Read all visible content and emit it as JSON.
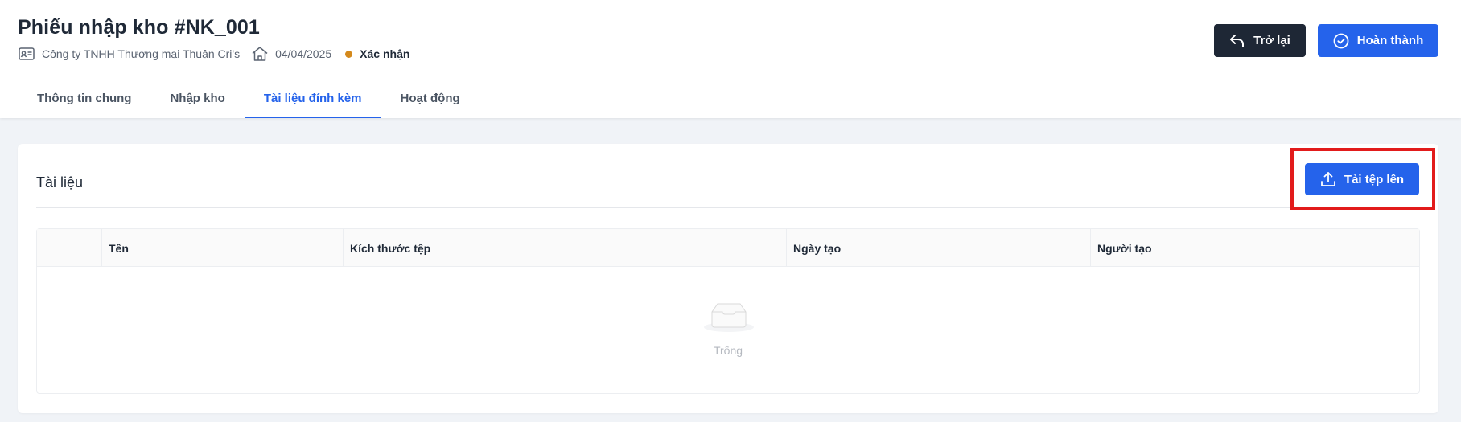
{
  "header": {
    "title": "Phiếu nhập kho #NK_001",
    "company": "Công ty TNHH Thương mại Thuận Cri's",
    "date": "04/04/2025",
    "status": "Xác nhận",
    "status_color": "#d4891c",
    "company_icon": "id-card-icon",
    "home_icon": "home-icon"
  },
  "actions": {
    "back_label": "Trở lại",
    "done_label": "Hoàn thành",
    "back_icon": "undo-arrow-icon",
    "done_icon": "check-circle-icon"
  },
  "tabs": [
    {
      "label": "Thông tin chung",
      "active": false
    },
    {
      "label": "Nhập kho",
      "active": false
    },
    {
      "label": "Tài liệu đính kèm",
      "active": true
    },
    {
      "label": "Hoạt động",
      "active": false
    }
  ],
  "documents": {
    "title": "Tài liệu",
    "upload_label": "Tải tệp lên",
    "upload_icon": "upload-icon",
    "columns": [
      "",
      "Tên",
      "Kích thước tệp",
      "Ngày tạo",
      "Người tạo"
    ],
    "rows": [],
    "empty_text": "Trống",
    "empty_icon": "empty-inbox-icon"
  },
  "colors": {
    "primary": "#2563eb",
    "dark": "#1e2735",
    "highlight": "#e21b1b"
  }
}
